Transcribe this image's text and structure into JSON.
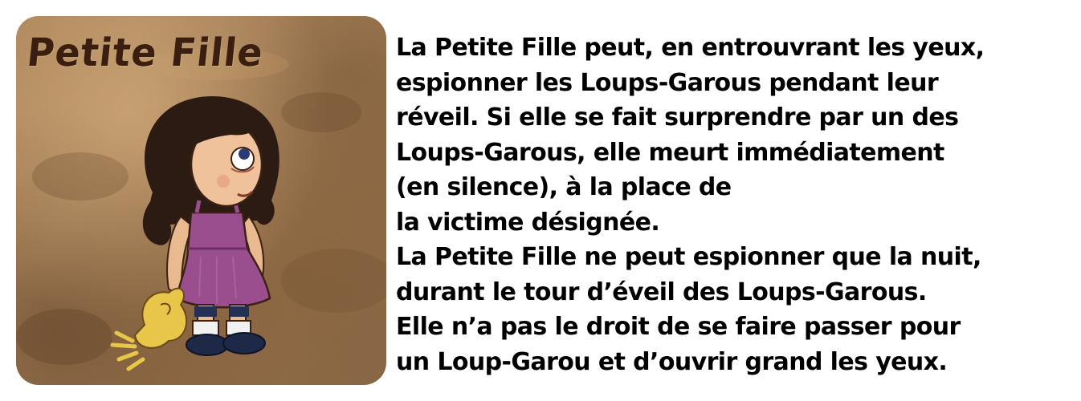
{
  "card": {
    "title": "Petite Fille",
    "image_subject": "little girl in purple dress holding a yellow toy",
    "colors": {
      "background": "#a98258",
      "title": "#3a1f10",
      "dress": "#9a4e8e",
      "hair": "#2b1b12",
      "toy": "#e8c64a"
    }
  },
  "description": {
    "lines": [
      "La Petite Fille peut, en entrouvrant les yeux,",
      "espionner les Loups-Garous pendant leur",
      "réveil. Si elle se fait surprendre par un des",
      "Loups-Garous, elle meurt immédiatement",
      "(en silence), à la place de",
      "la victime désignée.",
      "La Petite Fille ne peut espionner que la nuit,",
      "durant le tour d’éveil des Loups-Garous.",
      "Elle n’a pas le droit de se faire passer pour",
      "un Loup-Garou et d’ouvrir grand les yeux."
    ]
  }
}
